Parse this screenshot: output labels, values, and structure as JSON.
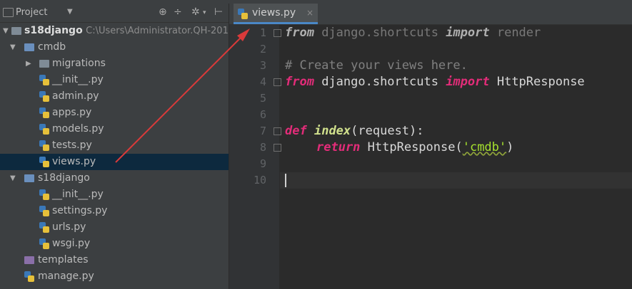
{
  "project_panel": {
    "title": "Project",
    "tree": [
      {
        "label": "s18django",
        "path": "C:\\Users\\Administrator.QH-201",
        "type": "folder-root"
      },
      {
        "label": "cmdb",
        "type": "folder"
      },
      {
        "label": "migrations",
        "type": "folder"
      },
      {
        "label": "__init__.py",
        "type": "py"
      },
      {
        "label": "admin.py",
        "type": "py"
      },
      {
        "label": "apps.py",
        "type": "py"
      },
      {
        "label": "models.py",
        "type": "py"
      },
      {
        "label": "tests.py",
        "type": "py"
      },
      {
        "label": "views.py",
        "type": "py",
        "selected": true
      },
      {
        "label": "s18django",
        "type": "folder"
      },
      {
        "label": "__init__.py",
        "type": "py"
      },
      {
        "label": "settings.py",
        "type": "py"
      },
      {
        "label": "urls.py",
        "type": "py"
      },
      {
        "label": "wsgi.py",
        "type": "py"
      },
      {
        "label": "templates",
        "type": "folder"
      },
      {
        "label": "manage.py",
        "type": "py"
      }
    ]
  },
  "editor": {
    "tab_label": "views.py",
    "tab_close": "×",
    "line_numbers": [
      "1",
      "2",
      "3",
      "4",
      "5",
      "6",
      "7",
      "8",
      "9",
      "10"
    ],
    "code": {
      "l1_kw1": "from",
      "l1_mid": " django.shortcuts ",
      "l1_kw2": "import",
      "l1_end": " render",
      "l3_comment": "# Create your views here.",
      "l4_kw1": "from",
      "l4_mid": " django.shortcuts ",
      "l4_kw2": "import",
      "l4_end": " HttpResponse",
      "l7_kw": "def",
      "l7_fn": "index",
      "l7_rest": "(request):",
      "l8_kw": "return",
      "l8_pre": " HttpResponse(",
      "l8_str": "'cmdb'",
      "l8_post": ")"
    }
  },
  "colors": {
    "keyword": "#e32c79",
    "annotation_arrow": "#d93a3a",
    "selection": "#0d293e"
  }
}
